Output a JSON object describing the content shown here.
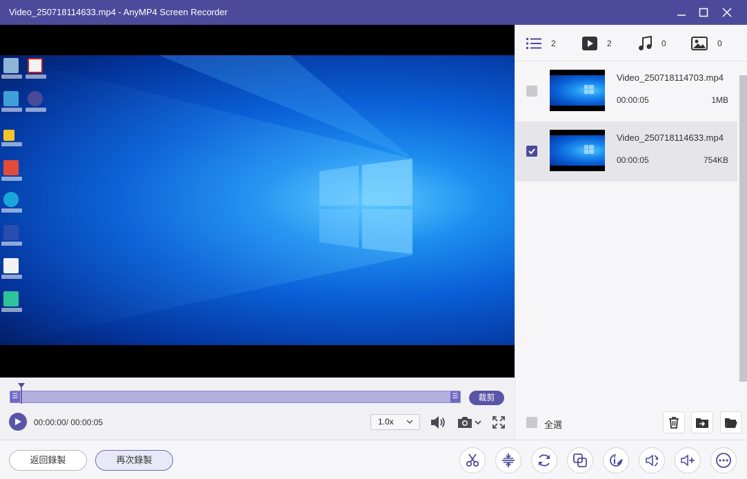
{
  "window": {
    "title": "Video_250718114633.mp4  -  AnyMP4 Screen Recorder"
  },
  "player": {
    "clip_label": "裁剪",
    "time": "00:00:00/ 00:00:05",
    "speed": "1.0x"
  },
  "tabs": [
    {
      "icon": "list-icon",
      "count": "2"
    },
    {
      "icon": "video-icon",
      "count": "2"
    },
    {
      "icon": "music-icon",
      "count": "0"
    },
    {
      "icon": "image-icon",
      "count": "0"
    }
  ],
  "recordings": [
    {
      "name": "Video_250718114703.mp4",
      "duration": "00:00:05",
      "size": "1MB",
      "checked": false
    },
    {
      "name": "Video_250718114633.mp4",
      "duration": "00:00:05",
      "size": "754KB",
      "checked": true
    }
  ],
  "panel": {
    "select_all": "全選"
  },
  "bottom": {
    "back_label": "返回錄製",
    "again_label": "再次錄製"
  },
  "colors": {
    "accent": "#4e4a9b",
    "timeline": "#b3afdf"
  }
}
